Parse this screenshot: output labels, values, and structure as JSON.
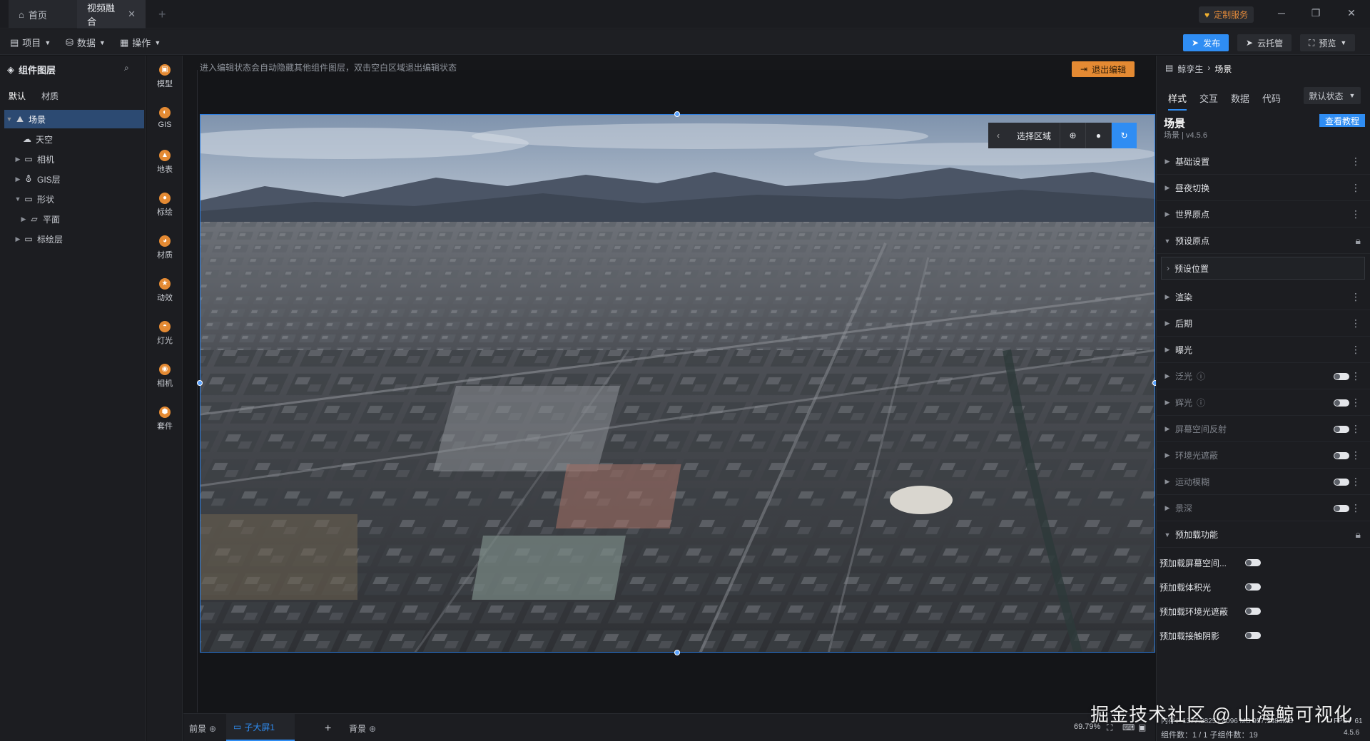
{
  "titlebar": {
    "tabs": [
      {
        "label": "首页"
      },
      {
        "label": "视频融合"
      }
    ],
    "custom_service": "定制服务"
  },
  "menubar": {
    "items": [
      {
        "label": "项目"
      },
      {
        "label": "数据"
      },
      {
        "label": "操作"
      }
    ],
    "publish": "发布",
    "cloud": "云托管",
    "preview": "预览"
  },
  "left": {
    "title": "组件图层",
    "tabs": [
      "默认",
      "材质"
    ],
    "tree": [
      {
        "label": "场景"
      },
      {
        "label": "天空"
      },
      {
        "label": "相机"
      },
      {
        "label": "GIS层"
      },
      {
        "label": "形状"
      },
      {
        "label": "平面"
      },
      {
        "label": "标绘层"
      }
    ]
  },
  "iconbar": [
    {
      "label": "模型",
      "icon": "model-icon"
    },
    {
      "label": "GIS",
      "icon": "gis-icon"
    },
    {
      "label": "地表",
      "icon": "terrain-icon"
    },
    {
      "label": "标绘",
      "icon": "marker-icon"
    },
    {
      "label": "材质",
      "icon": "material-icon"
    },
    {
      "label": "动效",
      "icon": "effect-icon"
    },
    {
      "label": "灯光",
      "icon": "light-icon"
    },
    {
      "label": "相机",
      "icon": "camera-icon"
    },
    {
      "label": "套件",
      "icon": "kit-icon"
    }
  ],
  "canvas": {
    "hint": "进入编辑状态会自动隐藏其他组件图层，双击空白区域退出编辑状态",
    "exit_edit": "退出编辑",
    "select_region": "选择区域"
  },
  "bottom": {
    "foreground": "前景",
    "screen": "子大屏1",
    "background": "背景",
    "zoom": "69.79%"
  },
  "right": {
    "breadcrumb": [
      "鲸孪生",
      "场景"
    ],
    "tabs": [
      "样式",
      "交互",
      "数据",
      "代码"
    ],
    "state": "默认状态",
    "title": "场景",
    "subtitle": "场景 | v4.5.6",
    "tutorial": "查看教程",
    "sections": [
      {
        "label": "基础设置"
      },
      {
        "label": "昼夜切换"
      },
      {
        "label": "世界原点"
      },
      {
        "label": "预设原点"
      },
      {
        "label": "预设位置"
      },
      {
        "label": "渲染"
      },
      {
        "label": "后期"
      },
      {
        "label": "曝光"
      },
      {
        "label": "泛光"
      },
      {
        "label": "辉光"
      },
      {
        "label": "屏幕空间反射"
      },
      {
        "label": "环境光遮蔽"
      },
      {
        "label": "运动模糊"
      },
      {
        "label": "景深"
      },
      {
        "label": "预加载功能"
      }
    ],
    "preload": [
      {
        "label": "预加载屏幕空间..."
      },
      {
        "label": "预加载体积光"
      },
      {
        "label": "预加载环境光遮蔽"
      },
      {
        "label": "预加载接触阴影"
      }
    ],
    "stats_line1": "内存：1377.3825 / 4096 MB  957.5484MB",
    "fps": "FPS：61",
    "stats_line2": "组件数：1 / 1   子组件数：19",
    "version": "4.5.6"
  },
  "watermark": "掘金技术社区 @ 山海鲸可视化",
  "colors": {
    "accent": "#2f8df3",
    "orange": "#e48a33",
    "bg": "#1c1d21"
  }
}
